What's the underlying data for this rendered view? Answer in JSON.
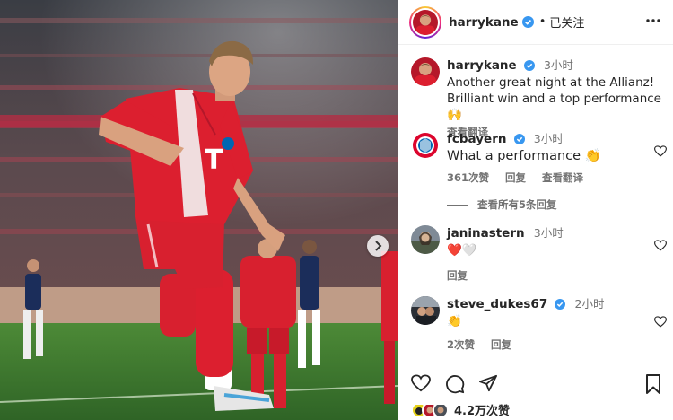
{
  "post": {
    "author": "harrykane",
    "follow_state": "已关注",
    "dot": "•",
    "caption": {
      "author": "harrykane",
      "time": "3小时",
      "text_line1": "Another great night at the Allianz!",
      "text_line2": "Brilliant win and a top performance 🙌",
      "translate": "查看翻译"
    },
    "comments": [
      {
        "user": "fcbayern",
        "time": "3小时",
        "text": "What a performance 👏",
        "likes": "361次赞",
        "reply": "回复",
        "translate": "查看翻译"
      },
      {
        "user": "janinastern",
        "time": "3小时",
        "text": "❤️🤍",
        "reply": "回复"
      },
      {
        "user": "steve_dukes67",
        "time": "2小时",
        "text": "👏",
        "likes": "2次赞",
        "reply": "回复"
      }
    ],
    "view_all_replies": "查看所有5条回复",
    "likes_count": "4.2万次赞",
    "jersey_number": "T"
  },
  "colors": {
    "verified": "#3897f0",
    "bayern_red": "#dc052d",
    "pitch_green": "#3f7a2e"
  },
  "icons": [
    "verified-badge-icon",
    "more-options-icon",
    "heart-icon",
    "comment-icon",
    "share-icon",
    "bookmark-icon",
    "chevron-right-icon"
  ]
}
